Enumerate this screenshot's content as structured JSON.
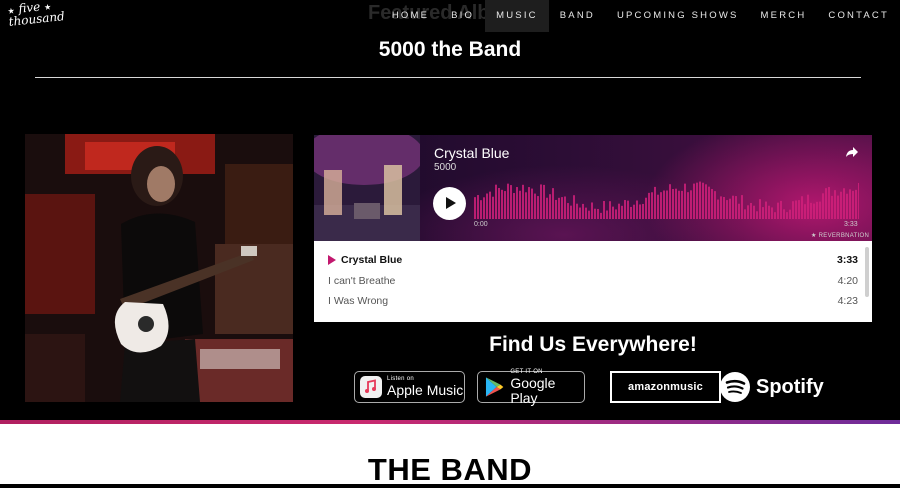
{
  "logo": {
    "line1": "five",
    "line2": "thousand"
  },
  "ghost_heading": "Featured Album",
  "nav": {
    "items": [
      "HOME",
      "BIO",
      "MUSIC",
      "BAND",
      "UPCOMING SHOWS",
      "MERCH",
      "CONTACT"
    ],
    "active": "MUSIC"
  },
  "section_title": "5000 the Band",
  "player": {
    "track_title": "Crystal Blue",
    "artist": "5000",
    "time_start": "0:00",
    "time_end": "3:33",
    "brand": "★ REVERBNATION",
    "tracks": [
      {
        "name": "Crystal Blue",
        "duration": "3:33"
      },
      {
        "name": "I can't Breathe",
        "duration": "4:20"
      },
      {
        "name": "I Was Wrong",
        "duration": "4:23"
      }
    ]
  },
  "find_us": "Find Us Everywhere!",
  "badges": {
    "apple": {
      "small": "Listen on",
      "big": "Apple Music"
    },
    "google": {
      "small": "GET IT ON",
      "big": "Google Play"
    },
    "amazon": {
      "text": "amazonmusic"
    },
    "spotify": {
      "text": "Spotify"
    }
  },
  "next_section_title": "THE BAND",
  "colors": {
    "accent": "#c2186e",
    "background": "#000000",
    "stripe_end": "#6e2c9a"
  }
}
